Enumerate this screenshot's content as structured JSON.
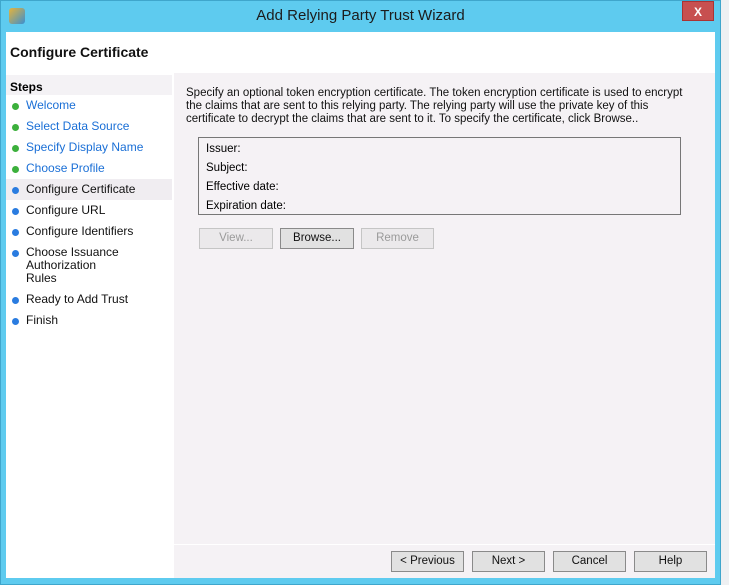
{
  "window": {
    "title": "Add Relying Party Trust Wizard",
    "close_label": "X"
  },
  "header": {
    "title": "Configure Certificate"
  },
  "steps": {
    "heading": "Steps",
    "items": [
      {
        "label": "Welcome",
        "state": "done"
      },
      {
        "label": "Select Data Source",
        "state": "done"
      },
      {
        "label": "Specify Display Name",
        "state": "done"
      },
      {
        "label": "Choose Profile",
        "state": "done"
      },
      {
        "label": "Configure Certificate",
        "state": "current"
      },
      {
        "label": "Configure URL",
        "state": "todo"
      },
      {
        "label": "Configure Identifiers",
        "state": "todo"
      },
      {
        "label": "Choose Issuance Authorization Rules",
        "state": "todo"
      },
      {
        "label": "Ready to Add Trust",
        "state": "todo"
      },
      {
        "label": "Finish",
        "state": "todo"
      }
    ]
  },
  "main": {
    "description": "Specify an optional token encryption certificate.  The token encryption certificate is used to encrypt the claims that are sent to this relying party.  The relying party will use the private key of this certificate to decrypt the claims that are sent to it.  To specify the certificate, click Browse..",
    "cert_fields": {
      "issuer": "Issuer:",
      "subject": "Subject:",
      "effective": "Effective date:",
      "expiration": "Expiration date:"
    },
    "view_label": "View...",
    "browse_label": "Browse...",
    "remove_label": "Remove"
  },
  "footer": {
    "previous": "< Previous",
    "next": "Next >",
    "cancel": "Cancel",
    "help": "Help"
  }
}
